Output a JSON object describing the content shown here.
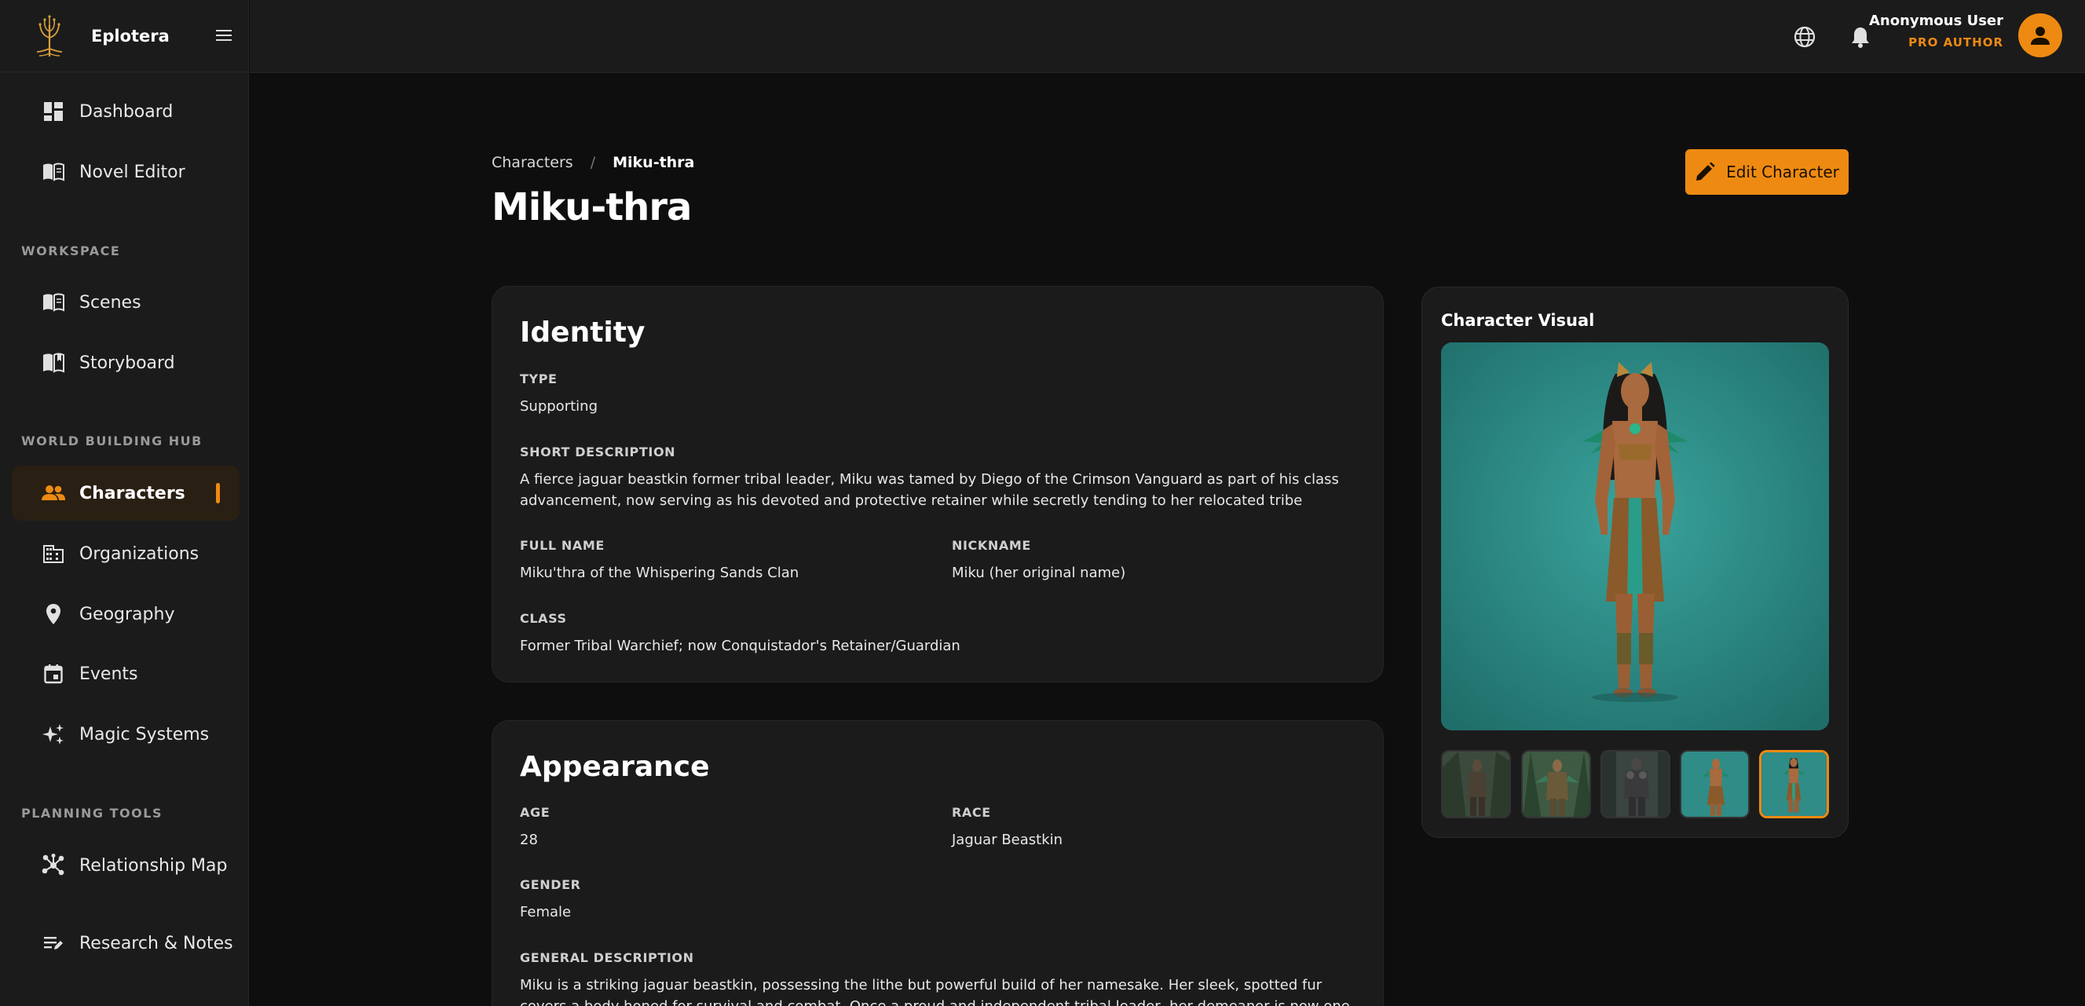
{
  "app": {
    "name": "Eplotera"
  },
  "sidebar": {
    "top_items": [
      {
        "label": "Dashboard",
        "icon": "dashboard-icon"
      },
      {
        "label": "Novel Editor",
        "icon": "book-open-icon"
      }
    ],
    "sections": [
      {
        "title": "WORKSPACE",
        "items": [
          {
            "label": "Scenes",
            "icon": "book-open-icon"
          },
          {
            "label": "Storyboard",
            "icon": "book-bookmark-icon"
          }
        ]
      },
      {
        "title": "WORLD BUILDING HUB",
        "items": [
          {
            "label": "Characters",
            "icon": "people-icon",
            "active": true
          },
          {
            "label": "Organizations",
            "icon": "building-icon"
          },
          {
            "label": "Geography",
            "icon": "map-pin-icon"
          },
          {
            "label": "Events",
            "icon": "calendar-icon"
          },
          {
            "label": "Magic Systems",
            "icon": "sparkles-icon"
          }
        ]
      },
      {
        "title": "PLANNING TOOLS",
        "items": [
          {
            "label": "Relationship Map",
            "icon": "network-icon"
          },
          {
            "label": "Research & Notes",
            "icon": "notes-icon"
          }
        ]
      }
    ]
  },
  "topbar": {
    "user_name": "Anonymous User",
    "user_role": "PRO AUTHOR"
  },
  "breadcrumb": {
    "parent": "Characters",
    "separator": "/",
    "current": "Miku-thra"
  },
  "page": {
    "title": "Miku-thra",
    "edit_label": "Edit Character"
  },
  "identity": {
    "title": "Identity",
    "type_label": "TYPE",
    "type": "Supporting",
    "short_desc_label": "SHORT DESCRIPTION",
    "short_desc": "A fierce jaguar beastkin former tribal leader, Miku was tamed by Diego of the Crimson Vanguard as part of his class advancement, now serving as his devoted and protective retainer while secretly tending to her relocated tribe",
    "full_name_label": "FULL NAME",
    "full_name": "Miku'thra of the Whispering Sands Clan",
    "nickname_label": "NICKNAME",
    "nickname": "Miku (her original name)",
    "class_label": "CLASS",
    "class": "Former Tribal Warchief; now Conquistador's Retainer/Guardian"
  },
  "appearance": {
    "title": "Appearance",
    "age_label": "AGE",
    "age": "28",
    "race_label": "RACE",
    "race": "Jaguar Beastkin",
    "gender_label": "GENDER",
    "gender": "Female",
    "general_label": "GENERAL DESCRIPTION",
    "general": "Miku is a striking jaguar beastkin, possessing the lithe but powerful build of her namesake. Her sleek, spotted fur covers a body honed for survival and combat. Once a proud and independent tribal leader, her demeanor is now one of stoic vigilance and fierce loyalty."
  },
  "visual": {
    "title": "Character Visual",
    "selected_index": 4,
    "thumb_count": 5
  },
  "colors": {
    "accent": "#ee8a12",
    "sidebar_bg": "#1b1b1b",
    "page_bg": "#0e0e0e",
    "card_bg": "#1b1b1b",
    "active_bg": "#2a1f13"
  }
}
